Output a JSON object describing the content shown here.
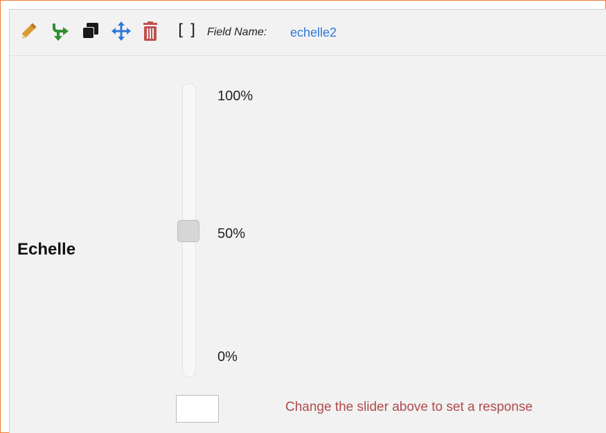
{
  "toolbar": {
    "icons": [
      "pencil-icon",
      "branch-icon",
      "copy-icon",
      "move-icon",
      "trash-icon"
    ],
    "brackets": "[ ]",
    "field_name_label": "Field Name:",
    "field_name_value": "echelle2"
  },
  "question": {
    "label": "Echelle"
  },
  "slider": {
    "min_label": "0%",
    "mid_label": "50%",
    "max_label": "100%",
    "value_percent": 50
  },
  "response": {
    "value": "",
    "hint": "Change the slider above to set a response"
  },
  "colors": {
    "frame_border": "#ed7d31",
    "panel_bg": "#f2f2f2",
    "pencil": "#d99b31",
    "branch": "#2f8f2f",
    "copy": "#1a1a1a",
    "move": "#2f79d9",
    "trash": "#c0504d",
    "field_value": "#2f79d9",
    "hint": "#b04a4a"
  }
}
